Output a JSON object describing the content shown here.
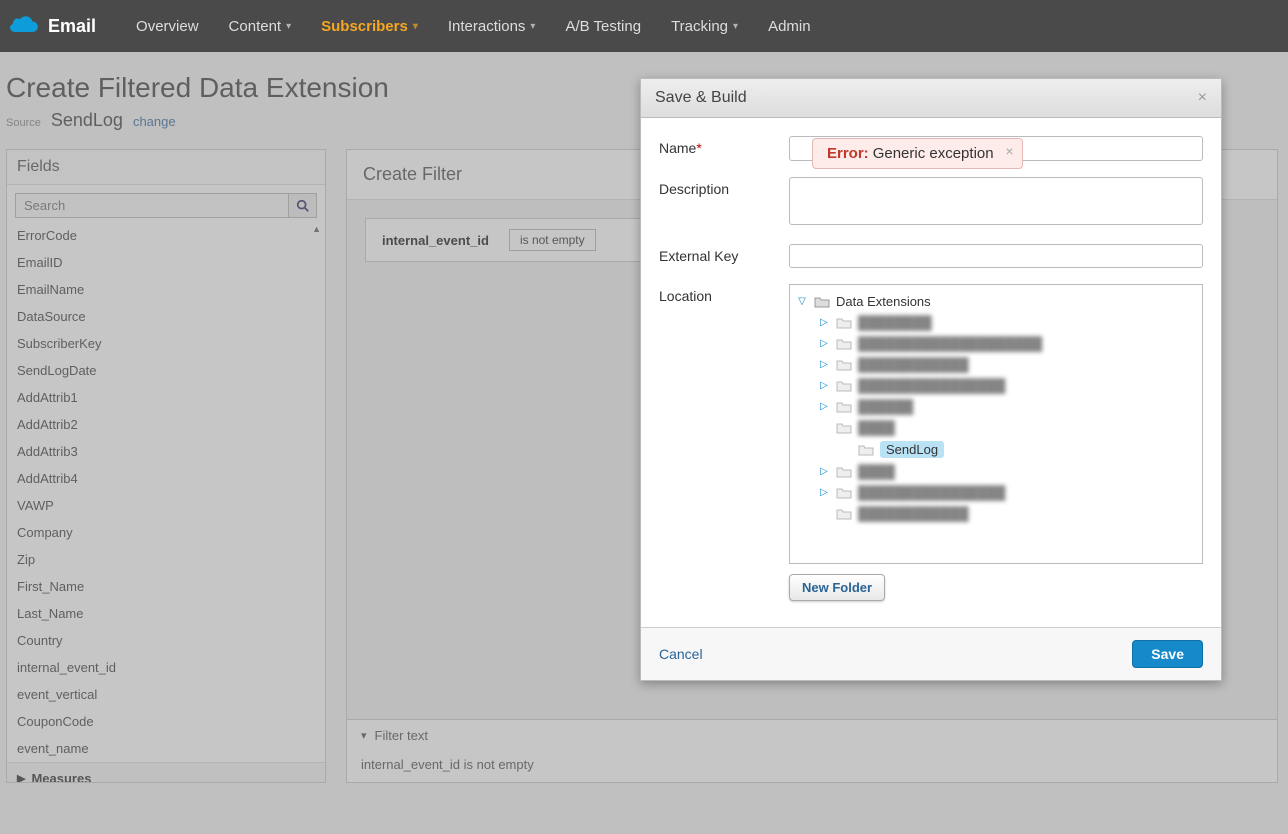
{
  "app_name": "Email",
  "nav": {
    "items": [
      {
        "label": "Overview",
        "has_chevron": false
      },
      {
        "label": "Content",
        "has_chevron": true
      },
      {
        "label": "Subscribers",
        "has_chevron": true,
        "active": true
      },
      {
        "label": "Interactions",
        "has_chevron": true
      },
      {
        "label": "A/B Testing",
        "has_chevron": false
      },
      {
        "label": "Tracking",
        "has_chevron": true
      },
      {
        "label": "Admin",
        "has_chevron": false
      }
    ]
  },
  "page": {
    "title": "Create Filtered Data Extension",
    "source_label": "Source",
    "source_name": "SendLog",
    "change_link": "change"
  },
  "fields_panel": {
    "header": "Fields",
    "search_placeholder": "Search",
    "fields": [
      "ErrorCode",
      "EmailID",
      "EmailName",
      "DataSource",
      "SubscriberKey",
      "SendLogDate",
      "AddAttrib1",
      "AddAttrib2",
      "AddAttrib3",
      "AddAttrib4",
      "VAWP",
      "Company",
      "Zip",
      "First_Name",
      "Last_Name",
      "Country",
      "internal_event_id",
      "event_vertical",
      "CouponCode",
      "event_name"
    ],
    "measures_label": "Measures"
  },
  "filter_panel": {
    "header": "Create Filter",
    "rule_field": "internal_event_id",
    "rule_operator": "is not empty",
    "filter_text_label": "Filter text",
    "filter_text_value": "internal_event_id  is not empty"
  },
  "modal": {
    "title": "Save & Build",
    "labels": {
      "name": "Name",
      "description": "Description",
      "external_key": "External Key",
      "location": "Location"
    },
    "name_value": "",
    "description_value": "",
    "external_key_value": "",
    "tree": {
      "root_label": "Data Extensions",
      "children": [
        {
          "blurred": true,
          "expandable": true
        },
        {
          "blurred": true,
          "expandable": true
        },
        {
          "blurred": true,
          "expandable": true
        },
        {
          "blurred": true,
          "expandable": true
        },
        {
          "blurred": true,
          "expandable": true
        },
        {
          "blurred": true,
          "expandable": false,
          "children": [
            {
              "label": "SendLog",
              "selected": true
            }
          ]
        },
        {
          "blurred": true,
          "expandable": true
        },
        {
          "blurred": true,
          "expandable": true
        },
        {
          "blurred": true,
          "expandable": false
        }
      ]
    },
    "new_folder_label": "New Folder",
    "cancel_label": "Cancel",
    "save_label": "Save"
  },
  "error": {
    "prefix": "Error:",
    "message": "Generic exception"
  }
}
